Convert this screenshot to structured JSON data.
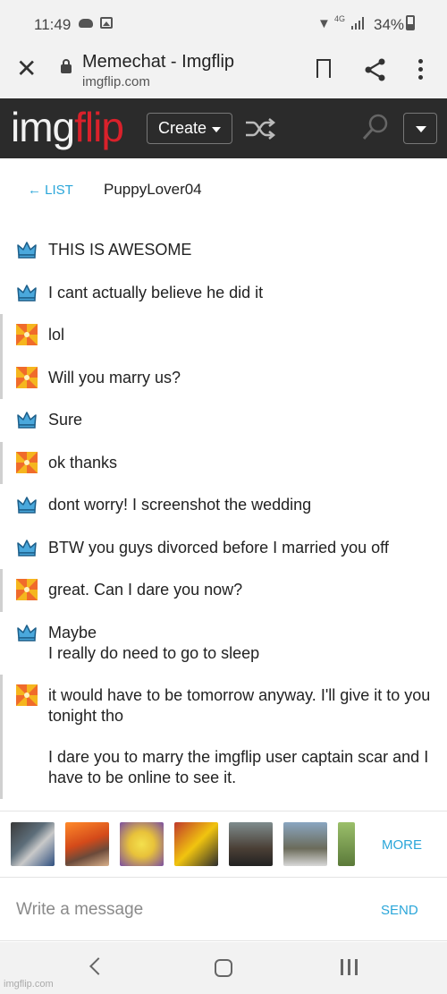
{
  "status_bar": {
    "time": "11:49",
    "network": "4G",
    "battery": "34%"
  },
  "browser": {
    "title": "Memechat - Imgflip",
    "url": "imgflip.com"
  },
  "header": {
    "logo_img": "img",
    "logo_flip": "flip",
    "create_label": "Create",
    "brand_color": "#d9212b"
  },
  "conversation": {
    "back_label": "← LIST",
    "partner": "PuppyLover04",
    "accent_color": "#2aa6d9"
  },
  "messages": [
    {
      "sender": "crown",
      "text": "THIS IS AWESOME"
    },
    {
      "sender": "crown",
      "text": "I cant actually believe he did it"
    },
    {
      "sender": "pinwheel",
      "text": "lol"
    },
    {
      "sender": "pinwheel",
      "text": "Will you marry us?"
    },
    {
      "sender": "crown",
      "text": "Sure"
    },
    {
      "sender": "pinwheel",
      "text": "ok thanks"
    },
    {
      "sender": "crown",
      "text": "dont worry! I screenshot the wedding"
    },
    {
      "sender": "crown",
      "text": "BTW you guys divorced before I married you off"
    },
    {
      "sender": "pinwheel",
      "text": "great. Can I dare you now?"
    },
    {
      "sender": "crown",
      "text": "Maybe\nI really do need to go to sleep"
    },
    {
      "sender": "pinwheel",
      "text": "it would have to be tomorrow anyway. I'll give it to you tonight tho\n\nI dare you to marry the imgflip user captain scar and I have to be online to see it."
    }
  ],
  "meme_strip": {
    "thumbnails": [
      "meme-thumb-1",
      "meme-thumb-2",
      "meme-thumb-3",
      "meme-thumb-4",
      "meme-thumb-5",
      "meme-thumb-6",
      "meme-thumb-7"
    ],
    "more_label": "MORE"
  },
  "composer": {
    "placeholder": "Write a message",
    "send_label": "SEND"
  },
  "watermark": "imgflip.com"
}
